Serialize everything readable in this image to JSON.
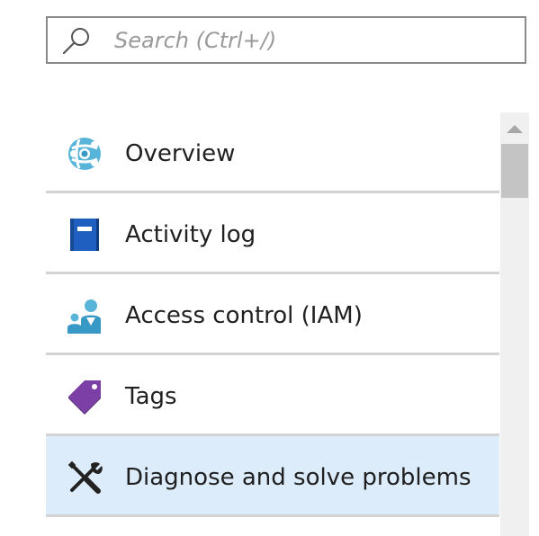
{
  "search": {
    "placeholder": "Search (Ctrl+/)",
    "value": "",
    "icon": "search-icon"
  },
  "menu": {
    "items": [
      {
        "label": "Overview",
        "icon": "overview-icon",
        "selected": false
      },
      {
        "label": "Activity log",
        "icon": "activity-log-icon",
        "selected": false
      },
      {
        "label": "Access control (IAM)",
        "icon": "access-control-icon",
        "selected": false
      },
      {
        "label": "Tags",
        "icon": "tag-icon",
        "selected": false
      },
      {
        "label": "Diagnose and solve problems",
        "icon": "tools-icon",
        "selected": true
      }
    ]
  },
  "colors": {
    "selected_background": "#ddecfb",
    "divider": "#d3d3d3",
    "accent_blue": "#2f7ed8",
    "tag_purple": "#7b3fa6",
    "scrollbar_track": "#f0f0f0",
    "scrollbar_thumb": "#c4c4c4"
  }
}
